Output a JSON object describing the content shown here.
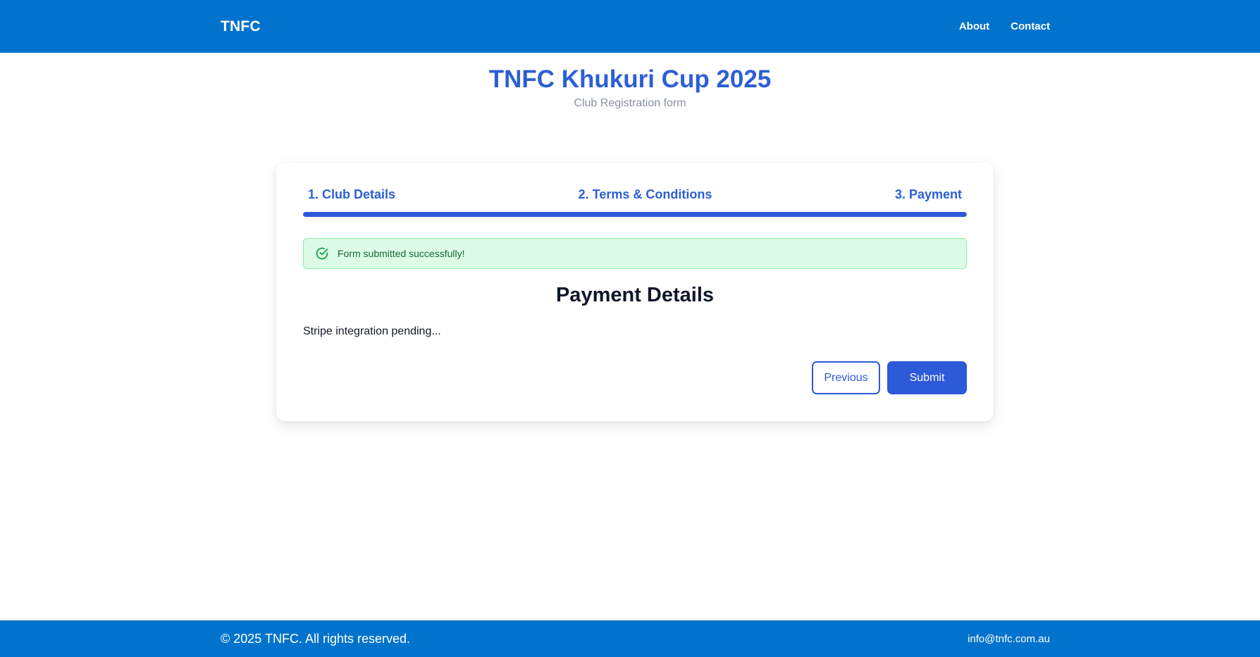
{
  "nav": {
    "brand": "TNFC",
    "links": [
      {
        "label": "About"
      },
      {
        "label": "Contact"
      }
    ]
  },
  "hero": {
    "title": "TNFC Khukuri Cup 2025",
    "subtitle": "Club Registration form"
  },
  "steps": [
    {
      "label": "1. Club Details"
    },
    {
      "label": "2. Terms & Conditions"
    },
    {
      "label": "3. Payment"
    }
  ],
  "progress": {
    "percent": 100,
    "current_step": 3,
    "total_steps": 3
  },
  "alert": {
    "icon": "check-circle-icon",
    "message": "Form submitted successfully!",
    "color": "#166534"
  },
  "payment": {
    "title": "Payment Details",
    "text": "Stripe integration pending..."
  },
  "actions": {
    "previous_label": "Previous",
    "submit_label": "Submit"
  },
  "footer": {
    "copyright": "© 2025 TNFC. All rights reserved.",
    "email": "info@tnfc.com.au"
  },
  "colors": {
    "brand_blue": "#0273cc",
    "accent": "#2c5ad9",
    "success_bg": "#dcfce7"
  }
}
